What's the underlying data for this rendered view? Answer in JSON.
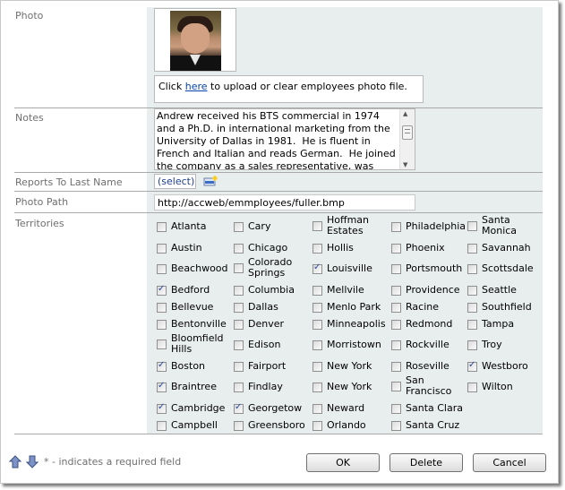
{
  "form": {
    "photo": {
      "label": "Photo",
      "upload_prefix": "Click ",
      "upload_link": "here",
      "upload_suffix": " to upload or clear employees photo file."
    },
    "notes": {
      "label": "Notes",
      "value": "Andrew received his BTS commercial in 1974 and a Ph.D. in international marketing from the University of Dallas in 1981.  He is fluent in French and Italian and reads German.  He joined the company as a sales representative, was"
    },
    "reports_to": {
      "label": "Reports To Last Name",
      "value": "(select)"
    },
    "photo_path": {
      "label": "Photo Path",
      "value": "http://accweb/emmployees/fuller.bmp"
    },
    "territories": {
      "label": "Territories",
      "columns": [
        [
          {
            "name": "Atlanta",
            "checked": false
          },
          {
            "name": "Austin",
            "checked": false
          },
          {
            "name": "Beachwood",
            "checked": false
          },
          {
            "name": "Bedford",
            "checked": true
          },
          {
            "name": "Bellevue",
            "checked": false
          },
          {
            "name": "Bentonville",
            "checked": false
          },
          {
            "name": "Bloomfield Hills",
            "checked": false
          },
          {
            "name": "Boston",
            "checked": true
          },
          {
            "name": "Braintree",
            "checked": true
          },
          {
            "name": "Cambridge",
            "checked": true
          },
          {
            "name": "Campbell",
            "checked": false
          }
        ],
        [
          {
            "name": "Cary",
            "checked": false
          },
          {
            "name": "Chicago",
            "checked": false
          },
          {
            "name": "Colorado Springs",
            "checked": false
          },
          {
            "name": "Columbia",
            "checked": false
          },
          {
            "name": "Dallas",
            "checked": false
          },
          {
            "name": "Denver",
            "checked": false
          },
          {
            "name": "Edison",
            "checked": false
          },
          {
            "name": "Fairport",
            "checked": false
          },
          {
            "name": "Findlay",
            "checked": false
          },
          {
            "name": "Georgetow",
            "checked": true
          },
          {
            "name": "Greensboro",
            "checked": false
          }
        ],
        [
          {
            "name": "Hoffman Estates",
            "checked": false
          },
          {
            "name": "Hollis",
            "checked": false
          },
          {
            "name": "Louisville",
            "checked": true
          },
          {
            "name": "Mellvile",
            "checked": false
          },
          {
            "name": "Menlo Park",
            "checked": false
          },
          {
            "name": "Minneapolis",
            "checked": false
          },
          {
            "name": "Morristown",
            "checked": false
          },
          {
            "name": "New York",
            "checked": false
          },
          {
            "name": "New York",
            "checked": false
          },
          {
            "name": "Neward",
            "checked": false
          },
          {
            "name": "Orlando",
            "checked": false
          }
        ],
        [
          {
            "name": "Philadelphia",
            "checked": false
          },
          {
            "name": "Phoenix",
            "checked": false
          },
          {
            "name": "Portsmouth",
            "checked": false
          },
          {
            "name": "Providence",
            "checked": false
          },
          {
            "name": "Racine",
            "checked": false
          },
          {
            "name": "Redmond",
            "checked": false
          },
          {
            "name": "Rockville",
            "checked": false
          },
          {
            "name": "Roseville",
            "checked": false
          },
          {
            "name": "San Francisco",
            "checked": false
          },
          {
            "name": "Santa Clara",
            "checked": false
          },
          {
            "name": "Santa Cruz",
            "checked": false
          }
        ],
        [
          {
            "name": "Santa Monica",
            "checked": false
          },
          {
            "name": "Savannah",
            "checked": false
          },
          {
            "name": "Scottsdale",
            "checked": false
          },
          {
            "name": "Seattle",
            "checked": false
          },
          {
            "name": "Southfield",
            "checked": false
          },
          {
            "name": "Tampa",
            "checked": false
          },
          {
            "name": "Troy",
            "checked": false
          },
          {
            "name": "Westboro",
            "checked": true
          },
          {
            "name": "Wilton",
            "checked": false
          }
        ]
      ]
    }
  },
  "footer": {
    "required_note": "* - indicates a required field",
    "ok_label": "OK",
    "delete_label": "Delete",
    "cancel_label": "Cancel"
  },
  "icons": {
    "move_up": "arrow-up-icon",
    "move_down": "arrow-down-icon",
    "new_record": "new-record-icon"
  },
  "colors": {
    "panel_bg": "#e8eded",
    "label_text": "#6f6f6f",
    "link": "#0645ad",
    "check": "#2c4a9c"
  }
}
